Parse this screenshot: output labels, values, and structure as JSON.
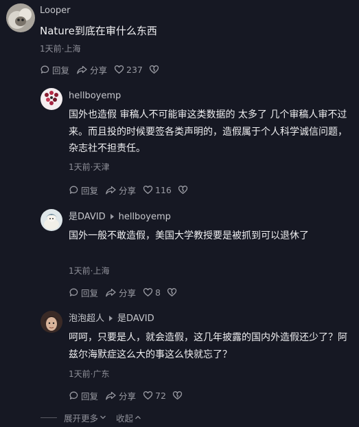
{
  "main_comment": {
    "author": "Looper",
    "text": "Nature到底在审什么东西",
    "meta": "1天前·上海",
    "reply_label": "回复",
    "share_label": "分享",
    "likes": "237"
  },
  "replies": [
    {
      "author": "hellboyemp",
      "reply_to": "",
      "text": "国外也造假  审稿人不可能审这类数据的 太多了  几个审稿人审不过来。而且投的时候要签各类声明的，造假属于个人科学诚信问题，杂志社不担责任。",
      "meta": "1天前·天津",
      "reply_label": "回复",
      "share_label": "分享",
      "likes": "116"
    },
    {
      "author": "是DAVID",
      "reply_to": "hellboyemp",
      "text": "国外一般不敢造假，美国大学教授要是被抓到可以退休了",
      "meta": "1天前·上海",
      "reply_label": "回复",
      "share_label": "分享",
      "likes": "8"
    },
    {
      "author": "泡泡超人",
      "reply_to": "是DAVID",
      "text": "呵呵，只要是人，就会造假，这几年披露的国内外造假还少了？阿兹尔海默症这么大的事这么快就忘了？",
      "meta": "1天前·广东",
      "reply_label": "回复",
      "share_label": "分享",
      "likes": "72"
    }
  ],
  "footer": {
    "expand_label": "展开更多",
    "collapse_label": "收起"
  },
  "colors": {
    "background": "#161823",
    "text": "#f1f1f3",
    "secondary": "#8f9099"
  }
}
